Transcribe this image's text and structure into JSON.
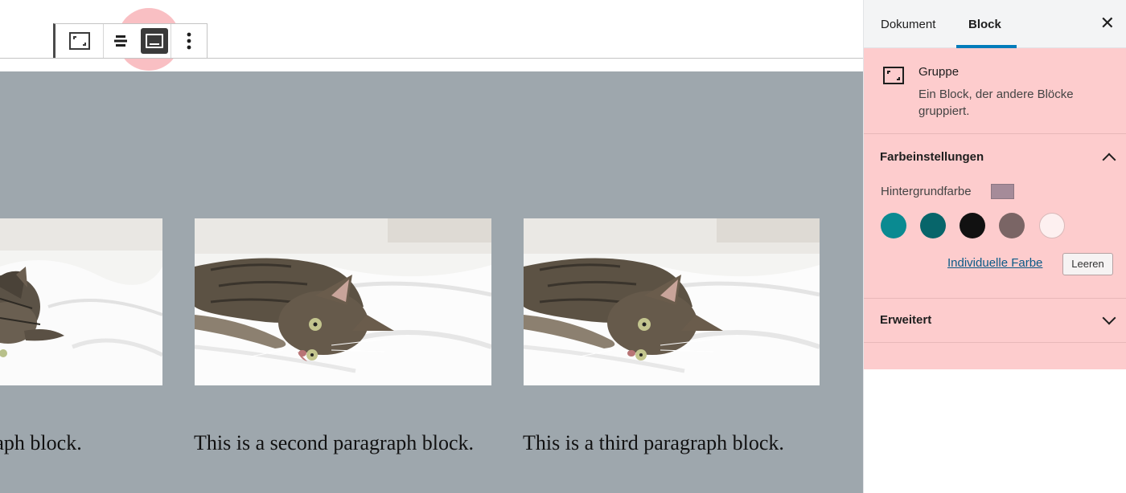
{
  "editor": {
    "toolbar": {
      "buttons": [
        {
          "name": "group-icon"
        },
        {
          "name": "align-icon"
        },
        {
          "name": "full-width-icon",
          "active": true
        },
        {
          "name": "more-options-icon"
        }
      ]
    },
    "group_background": "#9ea7ad",
    "paragraphs": [
      {
        "text": "This is a first paragraph block."
      },
      {
        "text": "This is a second paragraph block."
      },
      {
        "text": "This is a third paragraph block."
      }
    ]
  },
  "sidebar": {
    "tabs": [
      {
        "label": "Dokument"
      },
      {
        "label": "Block",
        "active": true
      }
    ],
    "close_icon": "close-icon",
    "block_card": {
      "icon": "group-icon",
      "title": "Gruppe",
      "description": "Ein Block, der andere Blöcke gruppiert."
    },
    "color_panel": {
      "title": "Farbeinstellungen",
      "expanded": true,
      "background_label": "Hintergrundfarbe",
      "current_color": "#a58b99",
      "palette": [
        "#0a8a91",
        "#07656a",
        "#111111",
        "#7a6565",
        "#fdf0f0"
      ],
      "custom_color_link": "Individuelle Farbe",
      "clear_button": "Leeren"
    },
    "advanced_panel": {
      "title": "Erweitert",
      "expanded": false
    },
    "highlight_color": "#fdcccd"
  }
}
